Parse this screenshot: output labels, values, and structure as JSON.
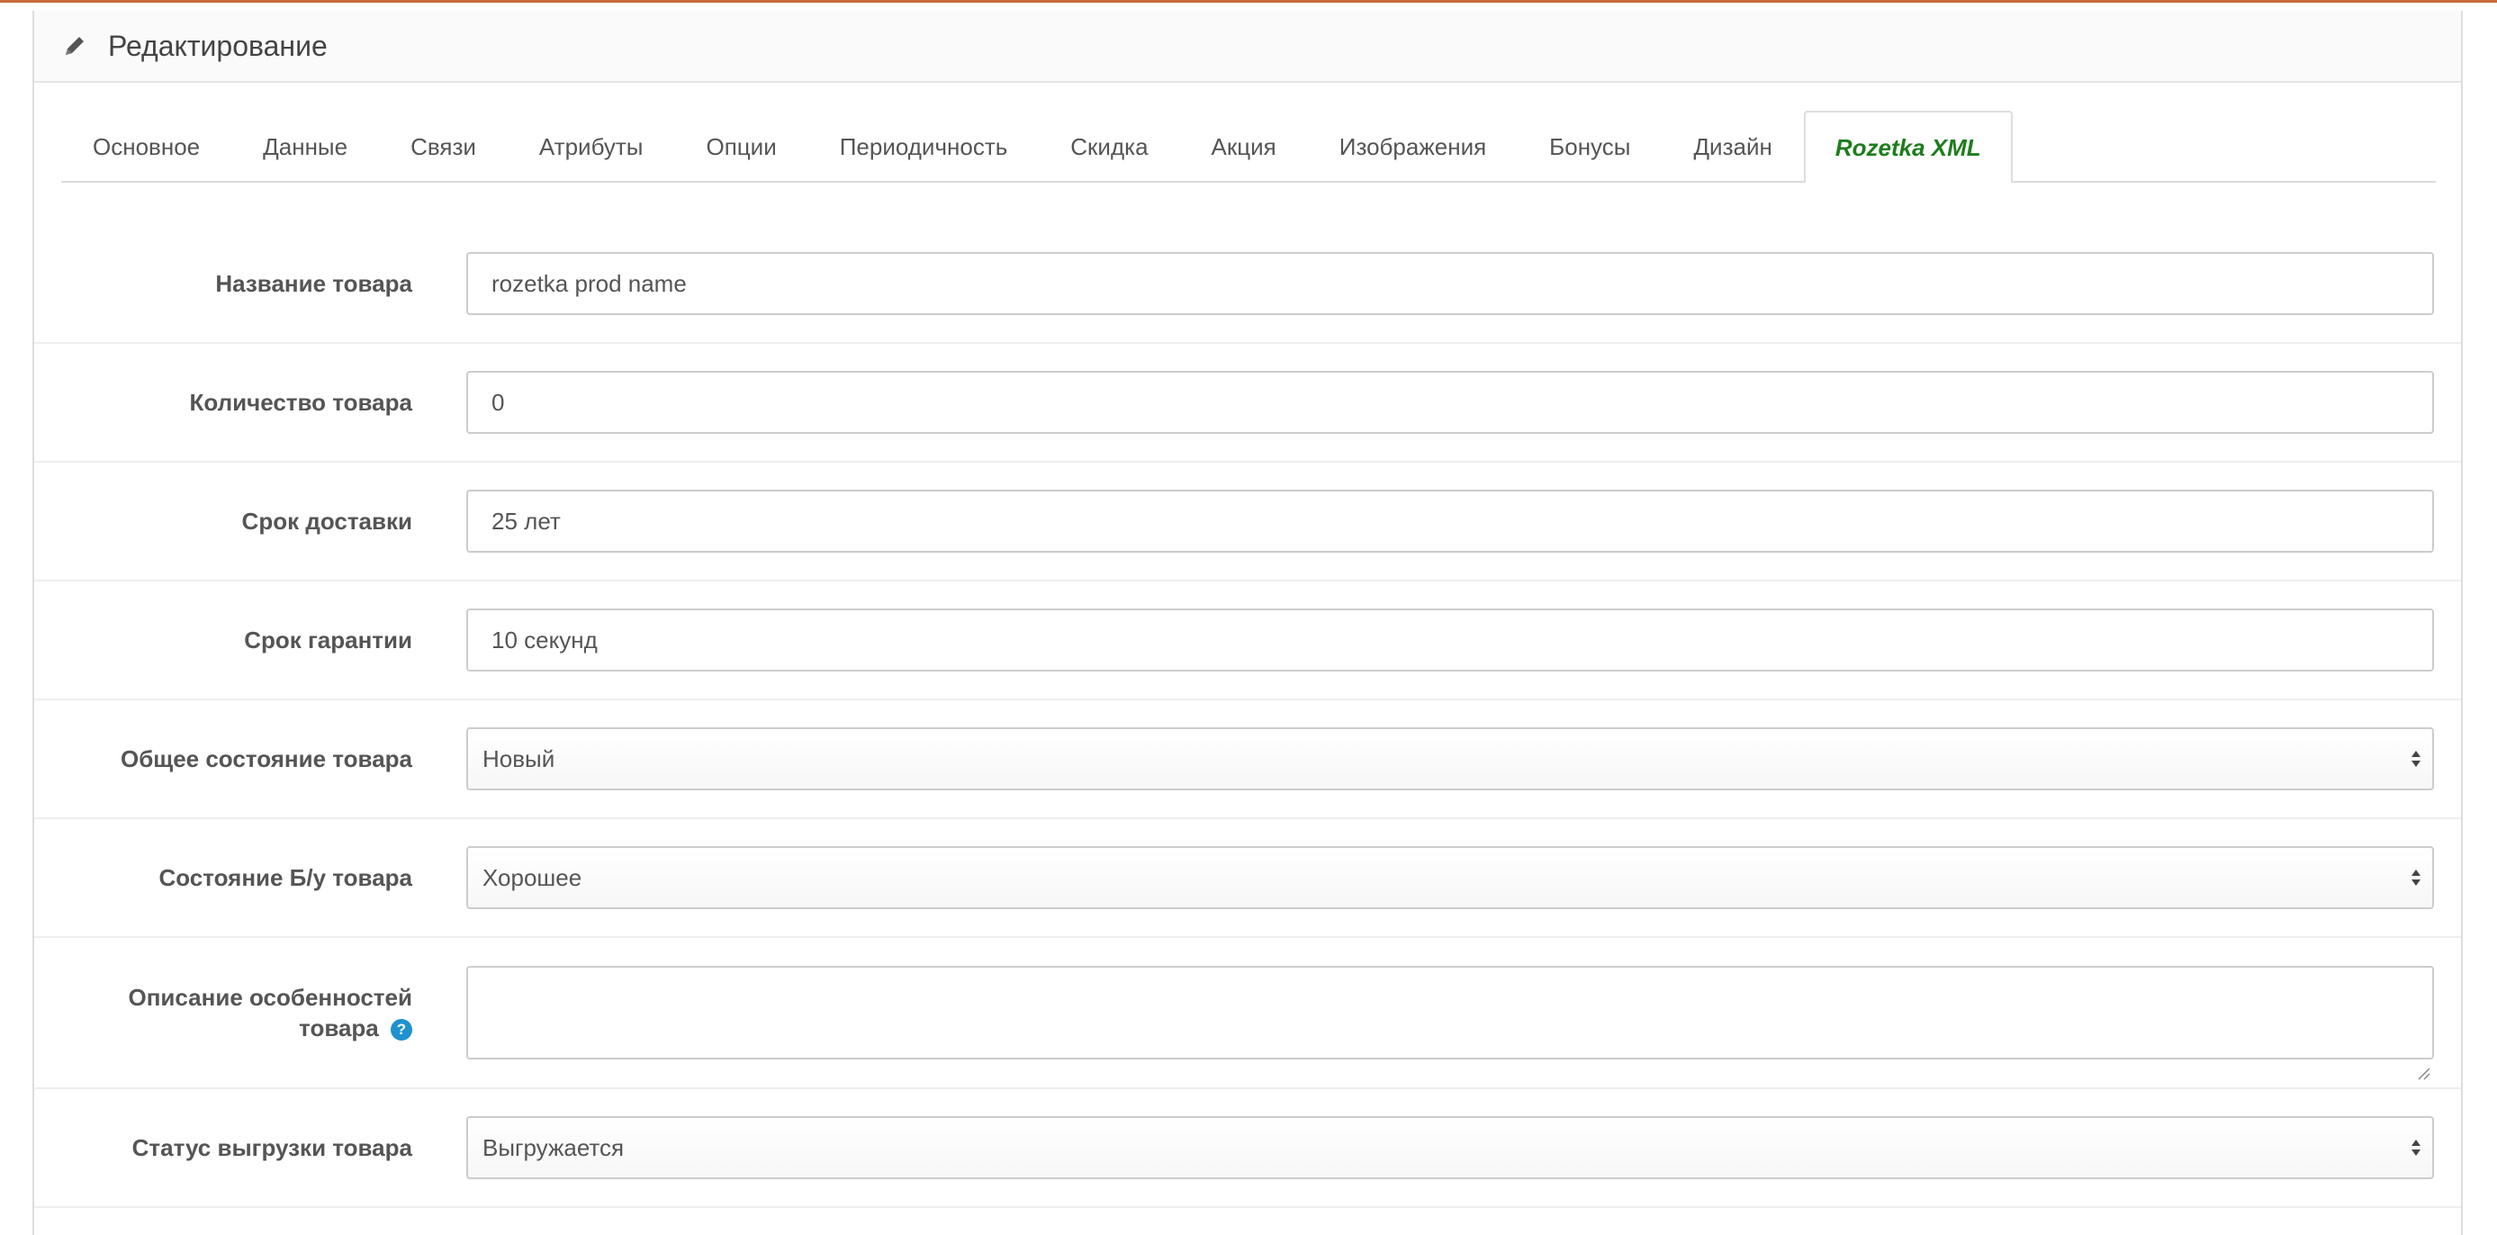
{
  "panel": {
    "title": "Редактирование",
    "title_icon": "pencil-icon"
  },
  "tabs": [
    {
      "label": "Основное"
    },
    {
      "label": "Данные"
    },
    {
      "label": "Связи"
    },
    {
      "label": "Атрибуты"
    },
    {
      "label": "Опции"
    },
    {
      "label": "Периодичность"
    },
    {
      "label": "Скидка"
    },
    {
      "label": "Акция"
    },
    {
      "label": "Изображения"
    },
    {
      "label": "Бонусы"
    },
    {
      "label": "Дизайн"
    },
    {
      "label": "Rozetka XML",
      "active": true
    }
  ],
  "form": {
    "name": {
      "label": "Название товара",
      "value": "rozetka prod name"
    },
    "quantity": {
      "label": "Количество товара",
      "value": "0"
    },
    "delivery": {
      "label": "Срок доставки",
      "value": "25 лет"
    },
    "warranty": {
      "label": "Срок гарантии",
      "value": "10 секунд"
    },
    "condition": {
      "label": "Общее состояние товара",
      "selected": "Новый"
    },
    "used_condition": {
      "label": "Состояние Б/у товара",
      "selected": "Хорошее"
    },
    "features": {
      "label_line1": "Описание особенностей",
      "label_line2": "товара",
      "help": "?",
      "value": ""
    },
    "export_status": {
      "label": "Статус выгрузки товара",
      "selected": "Выгружается"
    }
  },
  "colors": {
    "active_tab": "#1e7d1e",
    "help_icon": "#1e91cf",
    "top_accent": "#c76b3a"
  }
}
